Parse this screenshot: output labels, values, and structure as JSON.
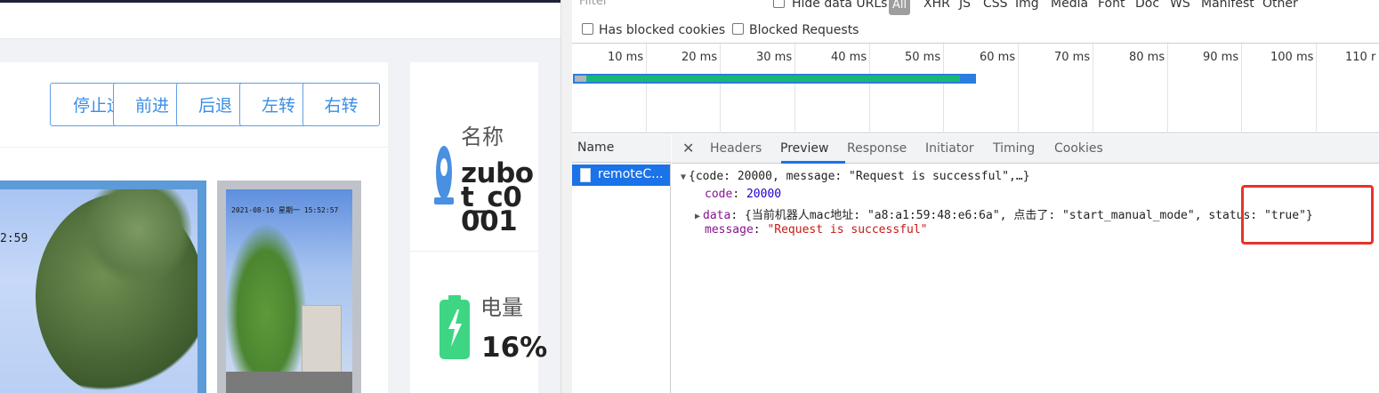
{
  "app": {
    "buttons": [
      "停止运",
      "前进",
      "后退",
      "左转",
      "右转"
    ],
    "camera_timestamp_1": "2:59",
    "camera_timestamp_2": "2021-08-16 星期一 15:52:57",
    "info": {
      "name_label": "名称",
      "name_value": "zubot_c0001",
      "power_label": "电量",
      "power_value": "16%"
    },
    "accent_color": "#3a8ee6"
  },
  "devtools": {
    "filter_placeholder": "Filter",
    "hide_data_urls": "Hide data URLs",
    "all": "All",
    "types": [
      "XHR",
      "JS",
      "CSS",
      "Img",
      "Media",
      "Font",
      "Doc",
      "WS",
      "Manifest",
      "Other"
    ],
    "has_blocked_cookies": "Has blocked cookies",
    "blocked_requests": "Blocked Requests",
    "timeline_ticks": [
      "10 ms",
      "20 ms",
      "30 ms",
      "40 ms",
      "50 ms",
      "60 ms",
      "70 ms",
      "80 ms",
      "90 ms",
      "100 ms",
      "110 r"
    ],
    "name_header": "Name",
    "request_name": "remoteC...",
    "tabs": [
      "Headers",
      "Preview",
      "Response",
      "Initiator",
      "Timing",
      "Cookies"
    ],
    "active_tab": "Preview",
    "preview": {
      "summary": "{code: 20000, message: \"Request is successful\",…}",
      "code_key": "code",
      "code_value": "20000",
      "data_key": "data",
      "data_value_part1": "{当前机器人mac地址: \"a8:a1:59:48:e6:6a\", 点击了: \"start_manual_mode\"",
      "data_value_part2": ", status: \"true\"}",
      "message_key": "message",
      "message_value": "\"Request is successful\""
    }
  }
}
